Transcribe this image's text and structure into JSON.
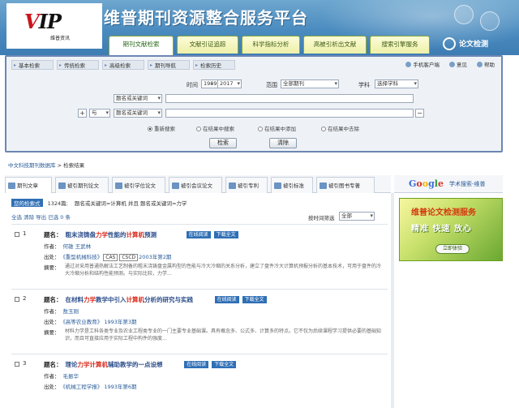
{
  "header": {
    "logo": "VIP",
    "logo_sub": "维普资讯",
    "site_title": "维普期刊资源整合服务平台"
  },
  "main_tabs": [
    {
      "label": "期刊文献检索",
      "active": true
    },
    {
      "label": "文献引证追踪",
      "active": false
    },
    {
      "label": "科学指标分析",
      "active": false
    },
    {
      "label": "高被引析出文献",
      "active": false
    },
    {
      "label": "搜索引擎服务",
      "active": false
    }
  ],
  "check_button": "论文检测",
  "search": {
    "subtabs": [
      "基本检索",
      "传统检索",
      "高级检索",
      "期刊导航",
      "检索历史"
    ],
    "top_links": [
      "手机客户端",
      "意见",
      "帮助"
    ],
    "time_label": "时间",
    "year_from": "1989",
    "year_to": "2017",
    "range_label": "范围",
    "range_value": "全部期刊",
    "subject_label": "学科",
    "subject_value": "选择学科",
    "field1": "题名或关键词",
    "field2": "题名或关键词",
    "logic": "与",
    "plus": "+",
    "minus": "−",
    "radios": [
      "重新搜索",
      "在结果中搜索",
      "在结果中添加",
      "在结果中去除"
    ],
    "search_btn": "检索",
    "clear_btn": "清除"
  },
  "breadcrumb": {
    "link": "中文科技期刊数据库",
    "sep": " > ",
    "current": "检索结果"
  },
  "result_tabs": [
    "期刊文章",
    "被引期刊论文",
    "被引学位论文",
    "被引会议论文",
    "被引专利",
    "被引标准",
    "被引图书专著"
  ],
  "google": {
    "logo": [
      "G",
      "o",
      "o",
      "g",
      "l",
      "e"
    ],
    "text": "学术搜索-维普"
  },
  "ad": {
    "line1": "维普论文检测服务",
    "line2": "精准 快速 放心",
    "button": "立即体验"
  },
  "results_meta": {
    "badge": "您的检索式",
    "count": "1324篇;",
    "query": "题名或关键词=计算机 并且 题名或关键词=力学",
    "actions": "全选 清除 导出  已选 0 条",
    "sort_label": "按时间筛选",
    "sort_value": "全部"
  },
  "results": [
    {
      "num": "1",
      "title_parts": [
        {
          "t": "粗末浇铸盘"
        },
        {
          "h": "力学"
        },
        {
          "t": "性能的"
        },
        {
          "h": "计算机"
        },
        {
          "t": "预测"
        }
      ],
      "tags": [
        "在线阅读",
        "下载全文"
      ],
      "author_label": "作者：",
      "authors": "何雄 王武林",
      "source_label": "出处：",
      "source": "《重型机械科技》",
      "source_tags": [
        "CAS",
        "CSCD"
      ],
      "source_year": "2003年第2期",
      "abstract_label": "摘要：",
      "abstract": "通过对采用普通热解法工艺制备的粗末浇铸盘金属构型的性能与冷大冷缩的关系分析，建立了盘件冷大计算机预报分析的基本技术，可用于盘件的冷大冷缩分析和结构性能预测。与实际比较，力学..."
    },
    {
      "num": "2",
      "title_parts": [
        {
          "t": "在材料"
        },
        {
          "h": "力学"
        },
        {
          "t": "教学中引入"
        },
        {
          "h": "计算机"
        },
        {
          "t": "分析的研究与实践"
        }
      ],
      "tags": [
        "在线阅读",
        "下载全文"
      ],
      "author_label": "作者：",
      "authors": "敖玉刚",
      "source_label": "出处：",
      "source": "《高等农业教育》",
      "source_tags": [],
      "source_year": "1993年第3期",
      "abstract_label": "摘要：",
      "abstract": "材料力学是工科各类专业及农业工程类专业的一门主要专业基础课。具有概念多、公式多、计算多的特点。它不仅为后续课程学习提供必要的基础知识，而且可直接应用于实际工程中构件的强度..."
    },
    {
      "num": "3",
      "title_parts": [
        {
          "t": "理论"
        },
        {
          "h": "力学"
        },
        {
          "h": "计算机"
        },
        {
          "t": "辅助教学的一点设想"
        }
      ],
      "tags": [
        "在线阅读",
        "下载全文"
      ],
      "author_label": "作者：",
      "authors": "毛振华",
      "source_label": "出处：",
      "source": "《机械工程学报》",
      "source_tags": [],
      "source_year": "1993年第6期"
    }
  ]
}
